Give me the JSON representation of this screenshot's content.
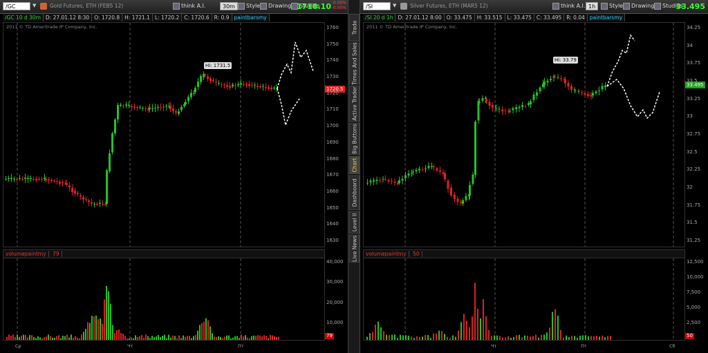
{
  "sidebar": {
    "tabs": [
      {
        "label": "Trade",
        "active": false
      },
      {
        "label": "Times And Sales",
        "active": false
      },
      {
        "label": "Active Trader",
        "active": false
      },
      {
        "label": "Big Buttons",
        "active": false
      },
      {
        "label": "Chart",
        "active": true
      },
      {
        "label": "Dashboard",
        "active": false
      },
      {
        "label": "Level II",
        "active": false
      },
      {
        "label": "Live News",
        "active": false
      }
    ]
  },
  "left": {
    "symbol": "/GC",
    "description": "Gold Futures, ETH (FEB5 12)",
    "thinkai": "think A.I.",
    "aggregation": "30m",
    "style_label": "Style",
    "drawings_label": "Drawings",
    "studies_label": "Studies",
    "last_price": "1718.10",
    "change_line1": "-0.00%",
    "change_line2": "-0.05%",
    "info": {
      "timeframe": "/GC 10 d 30m",
      "date": "D: 27.01.12 8:30",
      "open": "O: 1720.8",
      "high": "H: 1721.1",
      "low": "L: 1720.2",
      "close": "C: 1720.6",
      "range": "R: 0.9",
      "study": "paintbarsmy"
    },
    "copyright": "2011 © TD Ameritrade IP Company, Inc.",
    "hi_label": "Hi: 1731.5",
    "price_tag": "1720.5",
    "volume_study": "volumepaintmy",
    "volume_value": "79",
    "volume_tag": "79",
    "y_ticks": [
      "1760",
      "1750",
      "1740",
      "1730",
      "1720",
      "1710",
      "1700",
      "1690",
      "1680",
      "1670",
      "1660",
      "1650",
      "1640",
      "1630"
    ],
    "vy_ticks": [
      "40,000",
      "30,000",
      "20,000",
      "10,000"
    ],
    "x_ticks": [
      "Ср",
      "Чт",
      "Пт"
    ]
  },
  "right": {
    "symbol": "/SI",
    "description": "Silver Futures, ETH (MAR5 12)",
    "thinkai": "think A.I.",
    "aggregation": "1h",
    "style_label": "Style",
    "drawings_label": "Drawings",
    "studies_label": "Studies",
    "last_price": "33.495",
    "info": {
      "timeframe": "/SI 20 d 1h",
      "date": "D: 27.01.12 8:00",
      "open": "O: 33.475",
      "high": "H: 33.515",
      "low": "L: 33.475",
      "close": "C: 33.495",
      "range": "R: 0.04",
      "study": "paintbarsmy"
    },
    "copyright": "2011 © TD Ameritrade IP Company, Inc.",
    "hi_label": "Hi: 33.79",
    "price_tag": "33.495",
    "volume_study": "volumepaintmy",
    "volume_value": "50",
    "volume_tag": "50",
    "y_ticks": [
      "34.25",
      "34",
      "33.75",
      "33.5",
      "33.25",
      "33",
      "32.75",
      "32.5",
      "32.25",
      "32",
      "31.75",
      "31.5",
      "31.25"
    ],
    "vy_ticks": [
      "12,500",
      "10,000",
      "7,500",
      "5,000",
      "2,500"
    ],
    "x_ticks": [
      "Чт",
      "Пт",
      "Сб"
    ]
  },
  "colors": {
    "up": "#22c422",
    "down": "#e02020",
    "price_tag_left": "#e02020",
    "price_tag_right": "#22a022",
    "last_price": "#33ff33"
  }
}
